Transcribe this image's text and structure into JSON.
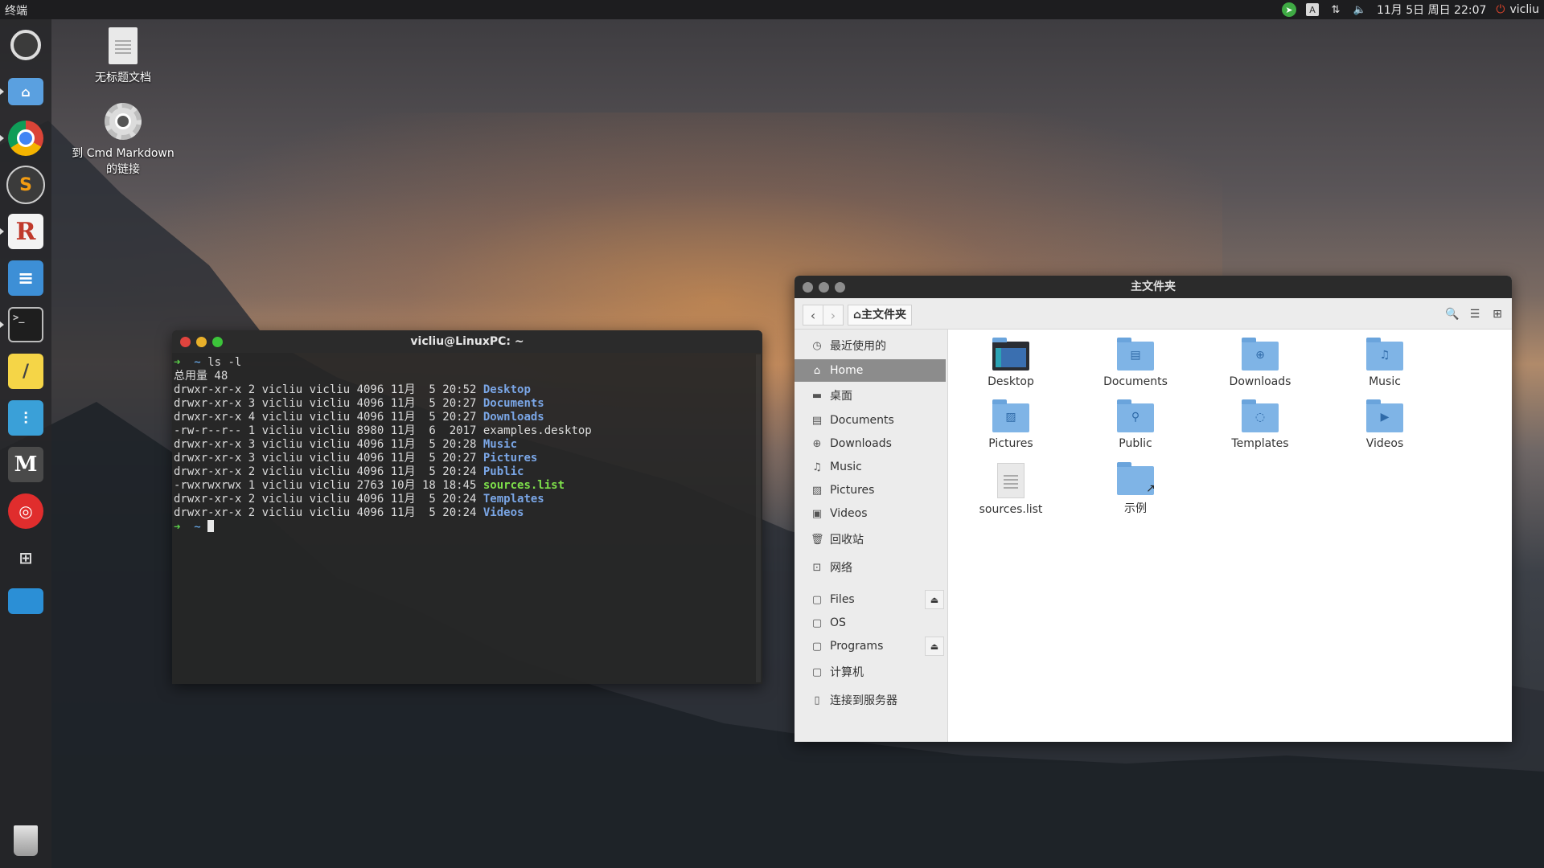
{
  "top_panel": {
    "app_title": "终端",
    "datetime": "11月 5日 周日 22:07",
    "user": "vicliu",
    "keyboard_indicator": "A",
    "icons": [
      "telegram-icon",
      "keyboard-icon",
      "network-icon",
      "volume-icon",
      "power-icon"
    ]
  },
  "launcher": {
    "items": [
      "ubuntu-settings",
      "files",
      "chrome",
      "sublime-text",
      "rstudio",
      "document-viewer",
      "terminal",
      "notes",
      "mixer",
      "markdown",
      "netease-music",
      "screen-tool",
      "workspace-switcher",
      "trash"
    ]
  },
  "desktop": {
    "icons": [
      {
        "label": "无标题文档"
      },
      {
        "label_line1": "到 Cmd Markdown",
        "label_line2": "的链接"
      }
    ]
  },
  "terminal": {
    "title": "vicliu@LinuxPC: ~",
    "command": "ls -l",
    "total": "总用量 48",
    "rows": [
      {
        "perms": "drwxr-xr-x",
        "links": "2",
        "owner": "vicliu",
        "group": "vicliu",
        "size": "4096",
        "month": "11月",
        "day": " 5",
        "time": "20:52",
        "name": "Desktop",
        "kind": "dir"
      },
      {
        "perms": "drwxr-xr-x",
        "links": "3",
        "owner": "vicliu",
        "group": "vicliu",
        "size": "4096",
        "month": "11月",
        "day": " 5",
        "time": "20:27",
        "name": "Documents",
        "kind": "dir"
      },
      {
        "perms": "drwxr-xr-x",
        "links": "4",
        "owner": "vicliu",
        "group": "vicliu",
        "size": "4096",
        "month": "11月",
        "day": " 5",
        "time": "20:27",
        "name": "Downloads",
        "kind": "dir"
      },
      {
        "perms": "-rw-r--r--",
        "links": "1",
        "owner": "vicliu",
        "group": "vicliu",
        "size": "8980",
        "month": "11月",
        "day": " 6",
        "time": " 2017",
        "name": "examples.desktop",
        "kind": "file"
      },
      {
        "perms": "drwxr-xr-x",
        "links": "3",
        "owner": "vicliu",
        "group": "vicliu",
        "size": "4096",
        "month": "11月",
        "day": " 5",
        "time": "20:28",
        "name": "Music",
        "kind": "dir"
      },
      {
        "perms": "drwxr-xr-x",
        "links": "3",
        "owner": "vicliu",
        "group": "vicliu",
        "size": "4096",
        "month": "11月",
        "day": " 5",
        "time": "20:27",
        "name": "Pictures",
        "kind": "dir"
      },
      {
        "perms": "drwxr-xr-x",
        "links": "2",
        "owner": "vicliu",
        "group": "vicliu",
        "size": "4096",
        "month": "11月",
        "day": " 5",
        "time": "20:24",
        "name": "Public",
        "kind": "dir"
      },
      {
        "perms": "-rwxrwxrwx",
        "links": "1",
        "owner": "vicliu",
        "group": "vicliu",
        "size": "2763",
        "month": "10月",
        "day": "18",
        "time": "18:45",
        "name": "sources.list",
        "kind": "exec"
      },
      {
        "perms": "drwxr-xr-x",
        "links": "2",
        "owner": "vicliu",
        "group": "vicliu",
        "size": "4096",
        "month": "11月",
        "day": " 5",
        "time": "20:24",
        "name": "Templates",
        "kind": "dir"
      },
      {
        "perms": "drwxr-xr-x",
        "links": "2",
        "owner": "vicliu",
        "group": "vicliu",
        "size": "4096",
        "month": "11月",
        "day": " 5",
        "time": "20:24",
        "name": "Videos",
        "kind": "dir"
      }
    ]
  },
  "file_manager": {
    "title": "主文件夹",
    "breadcrumb": "主文件夹",
    "sidebar": [
      {
        "label": "最近使用的",
        "icon": "clock-icon"
      },
      {
        "label": "Home",
        "icon": "home-icon",
        "active": true
      },
      {
        "label": "桌面",
        "icon": "folder-icon"
      },
      {
        "label": "Documents",
        "icon": "document-icon"
      },
      {
        "label": "Downloads",
        "icon": "download-icon"
      },
      {
        "label": "Music",
        "icon": "music-icon"
      },
      {
        "label": "Pictures",
        "icon": "picture-icon"
      },
      {
        "label": "Videos",
        "icon": "video-icon"
      },
      {
        "label": "回收站",
        "icon": "trash-icon"
      },
      {
        "label": "网络",
        "icon": "network-icon"
      },
      {
        "label": "Files",
        "icon": "drive-icon",
        "eject": true
      },
      {
        "label": "OS",
        "icon": "drive-icon"
      },
      {
        "label": "Programs",
        "icon": "drive-icon",
        "eject": true
      },
      {
        "label": "计算机",
        "icon": "drive-icon"
      },
      {
        "label": "连接到服务器",
        "icon": "server-icon"
      }
    ],
    "files": [
      {
        "label": "Desktop",
        "icon": "desktop-folder-icon"
      },
      {
        "label": "Documents",
        "icon": "documents-folder-icon"
      },
      {
        "label": "Downloads",
        "icon": "downloads-folder-icon"
      },
      {
        "label": "Music",
        "icon": "music-folder-icon"
      },
      {
        "label": "Pictures",
        "icon": "pictures-folder-icon"
      },
      {
        "label": "Public",
        "icon": "public-folder-icon"
      },
      {
        "label": "Templates",
        "icon": "templates-folder-icon"
      },
      {
        "label": "Videos",
        "icon": "videos-folder-icon"
      },
      {
        "label": "sources.list",
        "icon": "text-file-icon"
      },
      {
        "label": "示例",
        "icon": "link-folder-icon"
      }
    ]
  },
  "colors": {
    "panel": "#1d1d1f",
    "terminal_dir": "#7aa6e6",
    "terminal_exec": "#7ee04a",
    "terminal_prompt": "#5bd04a",
    "folder": "#7fb4e6",
    "sidebar_active": "#8c8c8c"
  }
}
